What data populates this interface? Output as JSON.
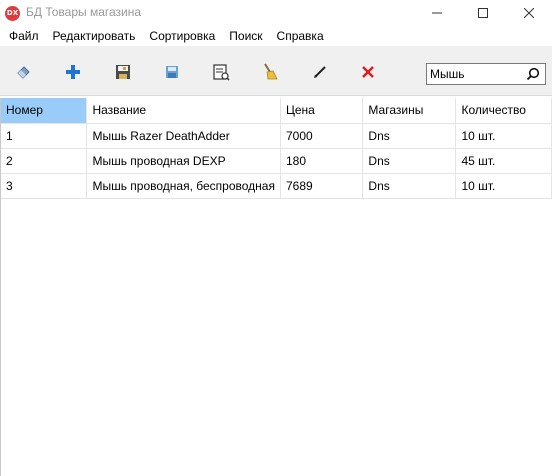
{
  "window": {
    "icon_text": "DX",
    "title": "БД Товары магазина"
  },
  "menu": [
    {
      "label": "Файл"
    },
    {
      "label": "Редактировать"
    },
    {
      "label": "Сортировка"
    },
    {
      "label": "Поиск"
    },
    {
      "label": "Справка"
    }
  ],
  "toolbar": {
    "icons": [
      "eraser-icon",
      "add-icon",
      "save-icon",
      "save-disk-icon",
      "print-preview-icon",
      "broom-icon",
      "edit-pencil-icon",
      "delete-icon"
    ]
  },
  "search": {
    "value": "Мышь"
  },
  "table": {
    "columns": [
      "Номер",
      "Название",
      "Цена",
      "Магазины",
      "Количество"
    ],
    "rows": [
      [
        "1",
        "Мышь Razer DeathAdder",
        "7000",
        "Dns",
        "10 шт."
      ],
      [
        "2",
        "Мышь проводная DEXP",
        "180",
        "Dns",
        "45 шт."
      ],
      [
        "3",
        "Мышь проводная, беспроводная",
        "7689",
        "Dns",
        "10 шт."
      ]
    ]
  },
  "colors": {
    "selected_header": "#99ccf8",
    "toolbar_bg": "#f0f0f0",
    "add_icon": "#1e73d6",
    "delete_icon": "#d92020"
  }
}
